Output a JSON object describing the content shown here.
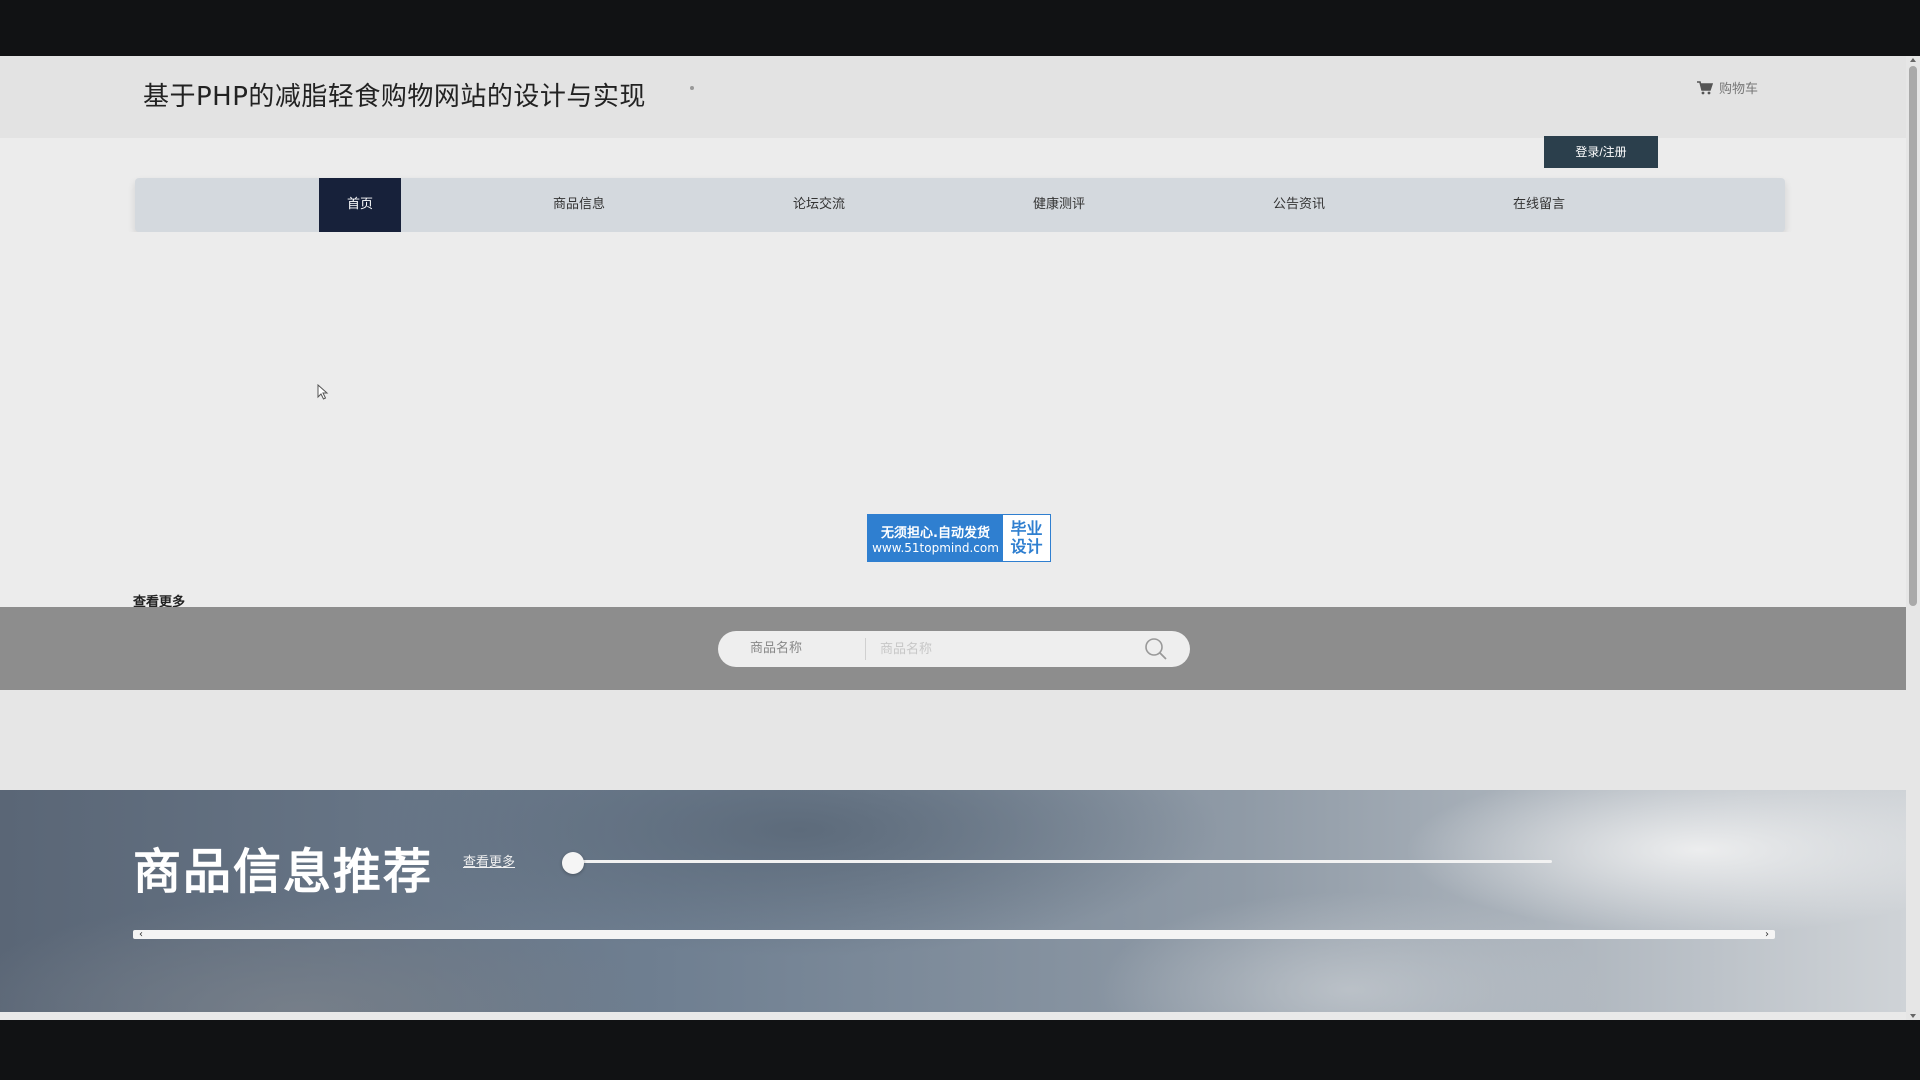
{
  "header": {
    "site_title": "基于PHP的减脂轻食购物网站的设计与实现",
    "cart_label": "购物车",
    "login_button": "登录/注册"
  },
  "nav": {
    "items": [
      {
        "label": "首页",
        "active": true
      },
      {
        "label": "商品信息",
        "active": false
      },
      {
        "label": "论坛交流",
        "active": false
      },
      {
        "label": "健康测评",
        "active": false
      },
      {
        "label": "公告资讯",
        "active": false
      },
      {
        "label": "在线留言",
        "active": false
      }
    ]
  },
  "banner": {
    "badge_line1": "无须担心.自动发货",
    "badge_line2": "www.51topmind.com",
    "badge_right_1": "毕业",
    "badge_right_2": "设计",
    "more_link": "查看更多"
  },
  "search": {
    "field_label": "商品名称",
    "placeholder": "商品名称"
  },
  "recommend": {
    "title": "商品信息推荐",
    "more_link": "查看更多",
    "slider_position": 0
  },
  "colors": {
    "nav_active_bg": "#17213a",
    "login_bg": "#2b3f4c",
    "badge_blue": "#2f7fd0"
  }
}
